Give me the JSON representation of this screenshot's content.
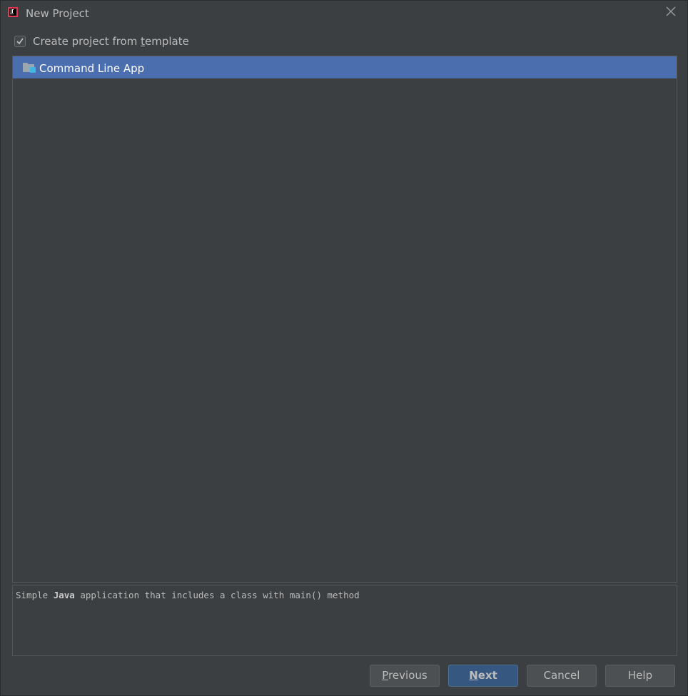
{
  "window": {
    "title": "New Project",
    "app_icon": "intellij-idea-icon",
    "close_icon": "close-icon"
  },
  "template_option": {
    "checked": true,
    "label_before": "Create project from ",
    "label_mnemonic": "t",
    "label_after": "emplate"
  },
  "templates": {
    "items": [
      {
        "label": "Command Line App",
        "icon": "folder-icon",
        "selected": true
      }
    ]
  },
  "description": {
    "text_before": "Simple ",
    "text_bold": "Java",
    "text_after": " application that includes a class with main() method"
  },
  "buttons": {
    "previous": {
      "mnemonic": "P",
      "rest": "revious",
      "enabled": false
    },
    "next": {
      "mnemonic": "N",
      "rest": "ext",
      "primary": true
    },
    "cancel": {
      "label": "Cancel"
    },
    "help": {
      "label": "Help"
    }
  },
  "colors": {
    "background": "#3c3f41",
    "selection": "#4b6eaf",
    "primary_button": "#365880",
    "text": "#bbbbbb"
  }
}
